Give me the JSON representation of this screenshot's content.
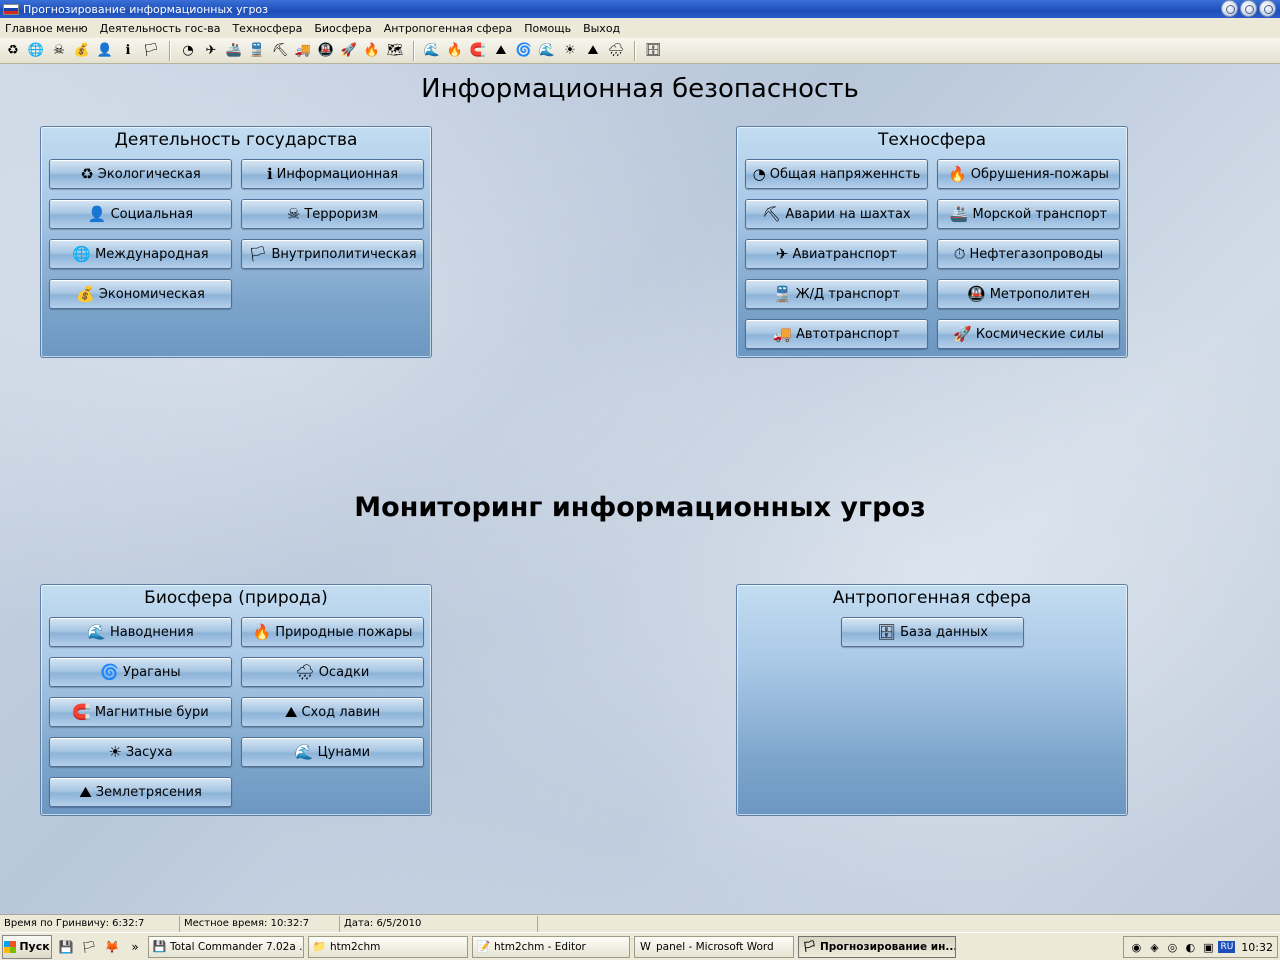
{
  "window": {
    "title": "Прогнозирование информационных угроз"
  },
  "menu": [
    "Главное меню",
    "Деятельность гос-ва",
    "Техносфера",
    "Биосфера",
    "Антропогенная сфера",
    "Помощь",
    "Выход"
  ],
  "toolbar": {
    "group1": [
      "recycle-icon",
      "globe-icon",
      "terrorist-icon",
      "money-icon",
      "person-icon",
      "info-icon",
      "flag-icon"
    ],
    "group2": [
      "gauge-icon",
      "plane-icon",
      "ship-icon",
      "train-icon",
      "hammer-icon",
      "truck-icon",
      "metro-icon",
      "rocket-icon",
      "fire-icon",
      "map-icon"
    ],
    "group3": [
      "flood-icon",
      "forest-fire-icon",
      "magnet-icon",
      "avalanche-icon",
      "hurricane-icon",
      "tsunami-icon",
      "sun-icon",
      "earthquake-icon",
      "rain-icon"
    ],
    "group4": [
      "database-icon"
    ]
  },
  "headings": {
    "security": "Информационная безопасность",
    "monitoring": "Мониторинг информационных угроз"
  },
  "panels": {
    "state": {
      "title": "Деятельность государства",
      "buttons": [
        {
          "label": "Экологическая",
          "icon": "♻"
        },
        {
          "label": "Информационная",
          "icon": "ℹ"
        },
        {
          "label": "Социальная",
          "icon": "👤"
        },
        {
          "label": "Терроризм",
          "icon": "☠"
        },
        {
          "label": "Международная",
          "icon": "🌐"
        },
        {
          "label": "Внутриполитическая",
          "icon": "🏳"
        },
        {
          "label": "Экономическая",
          "icon": "💰"
        }
      ]
    },
    "techno": {
      "title": "Техносфера",
      "buttons": [
        {
          "label": "Общая напряженнсть",
          "icon": "◔"
        },
        {
          "label": "Обрушения-пожары",
          "icon": "🔥"
        },
        {
          "label": "Аварии на шахтах",
          "icon": "⛏"
        },
        {
          "label": "Морской транспорт",
          "icon": "🚢"
        },
        {
          "label": "Авиатранспорт",
          "icon": "✈"
        },
        {
          "label": "Нефтегазопроводы",
          "icon": "⏱"
        },
        {
          "label": "Ж/Д транспорт",
          "icon": "🚆"
        },
        {
          "label": "Метрополитен",
          "icon": "🚇"
        },
        {
          "label": "Автотранспорт",
          "icon": "🚚"
        },
        {
          "label": "Космические силы",
          "icon": "🚀"
        }
      ]
    },
    "bio": {
      "title": "Биосфера (природа)",
      "buttons": [
        {
          "label": "Наводнения",
          "icon": "🌊"
        },
        {
          "label": "Природные пожары",
          "icon": "🔥"
        },
        {
          "label": "Ураганы",
          "icon": "🌀"
        },
        {
          "label": "Осадки",
          "icon": "🌧"
        },
        {
          "label": "Магнитные бури",
          "icon": "🧲"
        },
        {
          "label": "Сход лавин",
          "icon": "⛰"
        },
        {
          "label": "Засуха",
          "icon": "☀"
        },
        {
          "label": "Цунами",
          "icon": "🌊"
        },
        {
          "label": "Землетрясения",
          "icon": "⛰"
        }
      ]
    },
    "anthro": {
      "title": "Антропогенная сфера",
      "buttons": [
        {
          "label": "База данных",
          "icon": "🗄"
        }
      ]
    }
  },
  "statusbar": {
    "gmt": "Время по Гринвичу: 6:32:7",
    "local": "Местное время: 10:32:7",
    "date": "Дата: 6/5/2010"
  },
  "taskbar": {
    "start": "Пуск",
    "tasks": [
      {
        "label": "Total Commander 7.02a ...",
        "icon": "💾",
        "active": false
      },
      {
        "label": "htm2chm",
        "icon": "📁",
        "active": false
      },
      {
        "label": "htm2chm - Editor",
        "icon": "📝",
        "active": false
      },
      {
        "label": "panel - Microsoft Word",
        "icon": "W",
        "active": false
      },
      {
        "label": "Прогнозирование ин...",
        "icon": "🏳",
        "active": true
      }
    ],
    "lang": "RU",
    "clock": "10:32"
  }
}
